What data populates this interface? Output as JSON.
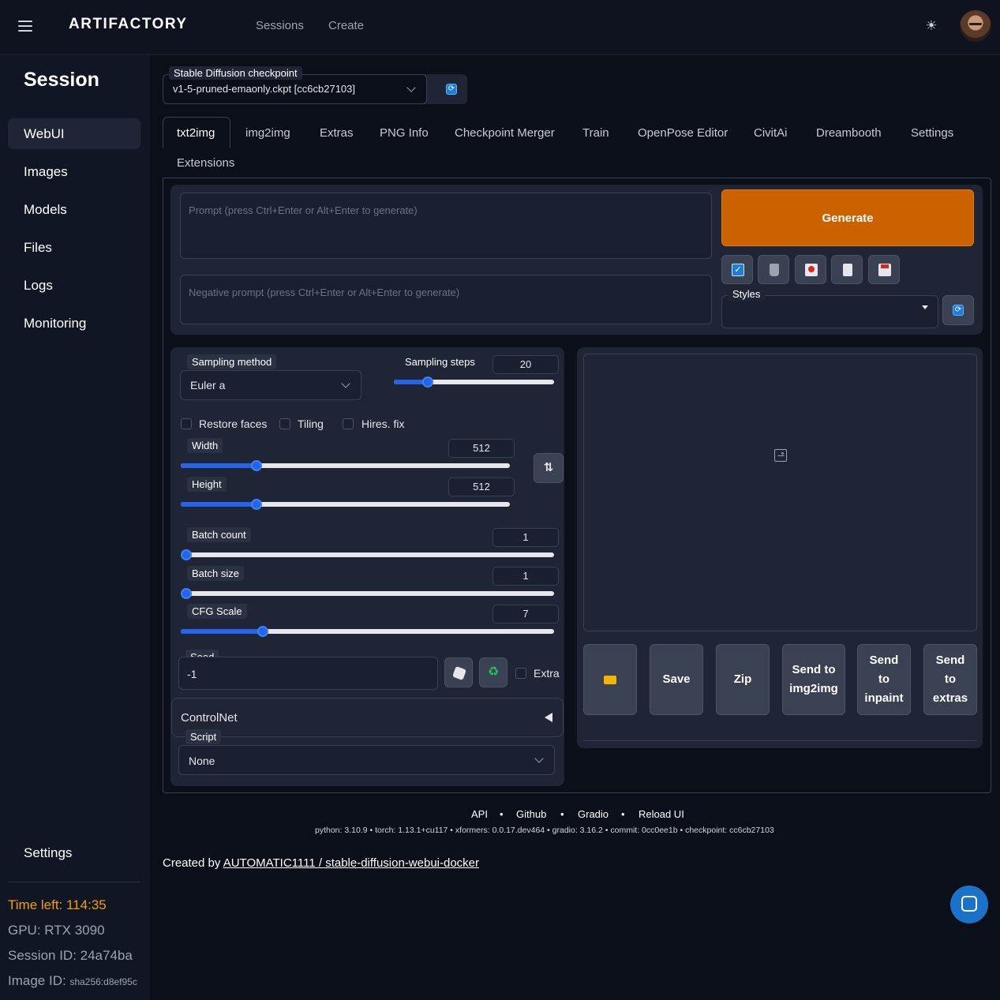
{
  "app": {
    "logo": "ARTIFACTORY",
    "nav": [
      "Sessions",
      "Create"
    ]
  },
  "sidebar": {
    "title": "Session",
    "items": [
      "WebUI",
      "Images",
      "Models",
      "Files",
      "Logs",
      "Monitoring"
    ],
    "settings": "Settings",
    "time_left": "Time left: 114:35",
    "gpu": "GPU: RTX 3090",
    "session_id": "Session ID: 24a74ba",
    "image_id_label": "Image ID:",
    "image_id_value": "sha256:d8ef95c"
  },
  "checkpoint": {
    "label": "Stable Diffusion checkpoint",
    "value": "v1-5-pruned-emaonly.ckpt [cc6cb27103]"
  },
  "tabs": [
    "txt2img",
    "img2img",
    "Extras",
    "PNG Info",
    "Checkpoint Merger",
    "Train",
    "OpenPose Editor",
    "CivitAi",
    "Dreambooth",
    "Settings",
    "Extensions"
  ],
  "prompt": {
    "placeholder": "Prompt (press Ctrl+Enter or Alt+Enter to generate)",
    "negative_placeholder": "Negative prompt (press Ctrl+Enter or Alt+Enter to generate)",
    "generate": "Generate",
    "styles_label": "Styles"
  },
  "settings": {
    "sampling_method_label": "Sampling method",
    "sampling_method_value": "Euler a",
    "sampling_steps_label": "Sampling steps",
    "sampling_steps": "20",
    "restore_faces": "Restore faces",
    "tiling": "Tiling",
    "hires_fix": "Hires. fix",
    "width_label": "Width",
    "width": "512",
    "height_label": "Height",
    "height": "512",
    "batch_count_label": "Batch count",
    "batch_count": "1",
    "batch_size_label": "Batch size",
    "batch_size": "1",
    "cfg_label": "CFG Scale",
    "cfg": "7",
    "seed_label": "Seed",
    "seed": "-1",
    "extra": "Extra",
    "controlnet": "ControlNet",
    "script_label": "Script",
    "script_value": "None"
  },
  "sliders": {
    "sampling_steps": 0.21,
    "width": 0.23,
    "height": 0.23,
    "batch_count": 0.0,
    "batch_size": 0.0,
    "cfg": 0.22
  },
  "output": {
    "buttons": [
      "Save",
      "Zip",
      "Send to img2img",
      "Send to inpaint",
      "Send to extras"
    ]
  },
  "footer": {
    "links": [
      "API",
      "Github",
      "Gradio",
      "Reload UI"
    ],
    "versions": "python: 3.10.9  •  torch: 1.13.1+cu117  •  xformers: 0.0.17.dev464  •  gradio: 3.16.2  •  commit: 0cc0ee1b  •  checkpoint: cc6cb27103",
    "credit_prefix": "Created by ",
    "credit_link": "AUTOMATIC1111 / stable-diffusion-webui-docker"
  },
  "colors": {
    "accent": "#cc6100",
    "slider": "#2563eb",
    "warn": "#f59e0b"
  }
}
